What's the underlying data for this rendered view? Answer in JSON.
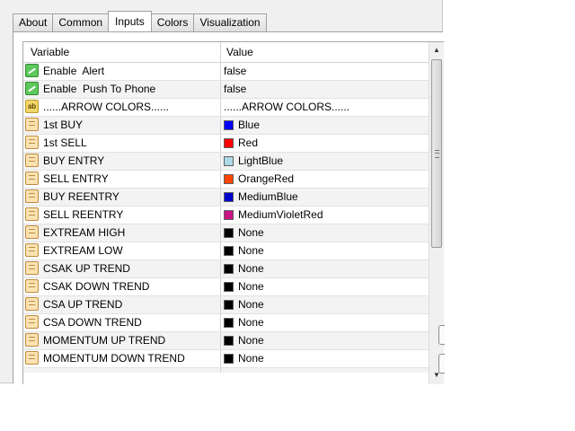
{
  "tabs": [
    {
      "label": "About"
    },
    {
      "label": "Common"
    },
    {
      "label": "Inputs"
    },
    {
      "label": "Colors"
    },
    {
      "label": "Visualization"
    }
  ],
  "active_tab": "Inputs",
  "columns": {
    "variable": "Variable",
    "value": "Value"
  },
  "rows": [
    {
      "icon": "green-bool-icon",
      "variable": "Enable  Alert",
      "value": "false"
    },
    {
      "icon": "green-bool-icon",
      "variable": "Enable  Push To Phone",
      "value": "false"
    },
    {
      "icon": "string-ab-icon",
      "variable": "......ARROW COLORS......",
      "value": "......ARROW COLORS......"
    },
    {
      "icon": "color-param-icon",
      "variable": "1st BUY",
      "value": "Blue",
      "color": "#0000ff"
    },
    {
      "icon": "color-param-icon",
      "variable": "1st SELL",
      "value": "Red",
      "color": "#ff0000"
    },
    {
      "icon": "color-param-icon",
      "variable": "BUY ENTRY",
      "value": "LightBlue",
      "color": "#add8e6"
    },
    {
      "icon": "color-param-icon",
      "variable": "SELL ENTRY",
      "value": "OrangeRed",
      "color": "#ff4500"
    },
    {
      "icon": "color-param-icon",
      "variable": "BUY REENTRY",
      "value": "MediumBlue",
      "color": "#0000cd"
    },
    {
      "icon": "color-param-icon",
      "variable": "SELL REENTRY",
      "value": "MediumVioletRed",
      "color": "#c71585"
    },
    {
      "icon": "color-param-icon",
      "variable": "EXTREAM HIGH",
      "value": "None",
      "color": "#000000"
    },
    {
      "icon": "color-param-icon",
      "variable": "EXTREAM LOW",
      "value": "None",
      "color": "#000000"
    },
    {
      "icon": "color-param-icon",
      "variable": "CSAK UP TREND",
      "value": "None",
      "color": "#000000"
    },
    {
      "icon": "color-param-icon",
      "variable": "CSAK DOWN TREND",
      "value": "None",
      "color": "#000000"
    },
    {
      "icon": "color-param-icon",
      "variable": "CSA UP TREND",
      "value": "None",
      "color": "#000000"
    },
    {
      "icon": "color-param-icon",
      "variable": "CSA DOWN TREND",
      "value": "None",
      "color": "#000000"
    },
    {
      "icon": "color-param-icon",
      "variable": "MOMENTUM UP TREND",
      "value": "None",
      "color": "#000000"
    },
    {
      "icon": "color-param-icon",
      "variable": "MOMENTUM DOWN TREND",
      "value": "None",
      "color": "#000000"
    }
  ]
}
